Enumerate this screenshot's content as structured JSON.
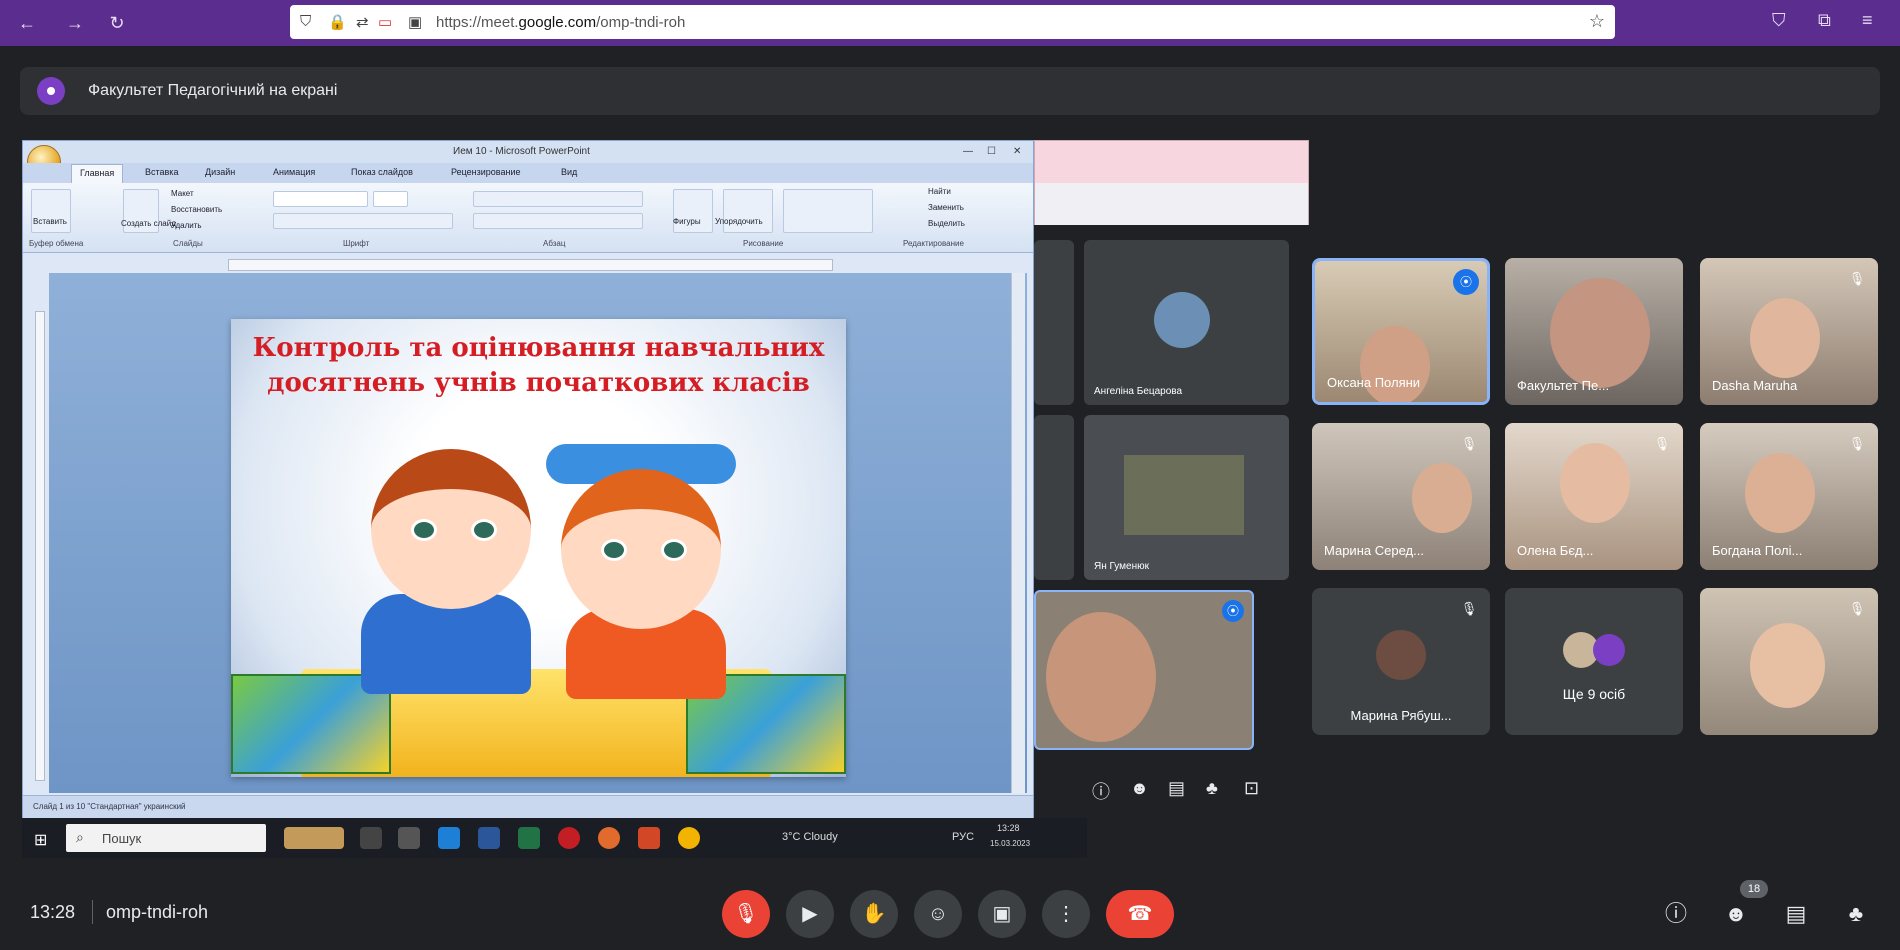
{
  "browser": {
    "url_prefix": "https://meet.",
    "url_domain": "google.com",
    "url_suffix": "/omp-tndi-roh",
    "back_icon": "←",
    "forward_icon": "→",
    "reload_icon": "↻"
  },
  "banner": {
    "text": "Факультет Педагогічний на екрані"
  },
  "shared_screen": {
    "ppt": {
      "window_title": "Ием 10 - Microsoft PowerPoint",
      "tabs": [
        "Главная",
        "Вставка",
        "Дизайн",
        "Анимация",
        "Показ слайдов",
        "Рецензирование",
        "Вид"
      ],
      "groups": [
        "Буфер обмена",
        "Слайды",
        "Шрифт",
        "Абзац",
        "Рисование",
        "Редактирование"
      ],
      "ribbon_buttons": [
        "Вставить",
        "Создать слайд",
        "Макет",
        "Восстановить",
        "Удалить",
        "Фигуры",
        "Упорядочить",
        "Найти",
        "Заменить",
        "Выделить"
      ],
      "status_text": "Слайд 1 из 10   \"Стандартная\"   украинский",
      "slide_title": "Контроль та оцінювання навчальних досягнень учнів початкових класів"
    },
    "taskbar": {
      "search_placeholder": "Пошук",
      "weather": "3°C  Cloudy",
      "lang": "РУС",
      "time": "13:28",
      "date": "15.03.2023"
    },
    "inner_tiles": [
      {
        "name": "Ангеліна Бецарова"
      },
      {
        "name": "Ян Гуменюк"
      }
    ]
  },
  "participants": [
    {
      "name": "Оксана Поляни",
      "speaking": true
    },
    {
      "name": "Факультет Пе...",
      "speaking": false
    },
    {
      "name": "Dasha Maruha",
      "speaking": false
    },
    {
      "name": "Марина Серед...",
      "speaking": false
    },
    {
      "name": "Олена Бєд...",
      "speaking": false
    },
    {
      "name": "Богдана Полі...",
      "speaking": false
    },
    {
      "name": "Марина Рябуш...",
      "speaking": false
    },
    {
      "name": "Ще 9 осіб",
      "speaking": false
    },
    {
      "name": "",
      "speaking": false
    }
  ],
  "bottom": {
    "time": "13:28",
    "meeting_code": "omp-tndi-roh",
    "participant_count": "18"
  },
  "colors": {
    "browser_purple": "#5b2d8e",
    "meet_bg": "#202124",
    "tile_bg": "#3c4043",
    "end_call_red": "#ea4335",
    "speaking_blue": "#8ab4f8",
    "title_red": "#d41e24"
  }
}
